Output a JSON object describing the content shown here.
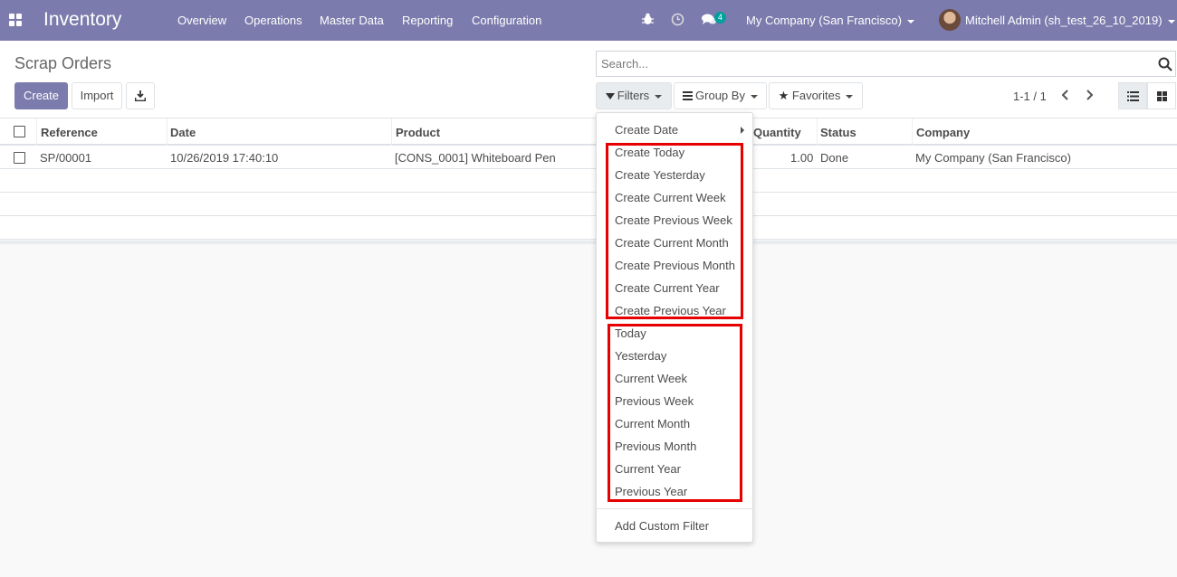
{
  "navbar": {
    "app_name": "Inventory",
    "menu": [
      "Overview",
      "Operations",
      "Master Data",
      "Reporting",
      "Configuration"
    ],
    "chat_badge": "4",
    "company": "My Company (San Francisco)",
    "user": "Mitchell Admin (sh_test_26_10_2019)",
    "brand_color": "#7c7bad"
  },
  "control_panel": {
    "title": "Scrap Orders",
    "create_label": "Create",
    "import_label": "Import",
    "search_placeholder": "Search...",
    "filters_label": "Filters",
    "group_by_label": "Group By",
    "favorites_label": "Favorites",
    "pager": "1-1 / 1"
  },
  "table": {
    "columns": [
      "Reference",
      "Date",
      "Product",
      "Quantity",
      "Status",
      "Company"
    ],
    "rows": [
      {
        "reference": "SP/00001",
        "date": "10/26/2019 17:40:10",
        "product": "[CONS_0001] Whiteboard Pen",
        "quantity": "1.00",
        "status": "Done",
        "company": "My Company (San Francisco)"
      }
    ]
  },
  "filters_dropdown": {
    "group_header": "Create Date",
    "create_date_filters": [
      "Create Today",
      "Create Yesterday",
      "Create Current Week",
      "Create Previous Week",
      "Create Current Month",
      "Create Previous Month",
      "Create Current Year",
      "Create Previous Year"
    ],
    "date_filters": [
      "Today",
      "Yesterday",
      "Current Week",
      "Previous Week",
      "Current Month",
      "Previous Month",
      "Current Year",
      "Previous Year"
    ],
    "custom_filter_label": "Add Custom Filter",
    "highlight_color": "#e60000"
  }
}
